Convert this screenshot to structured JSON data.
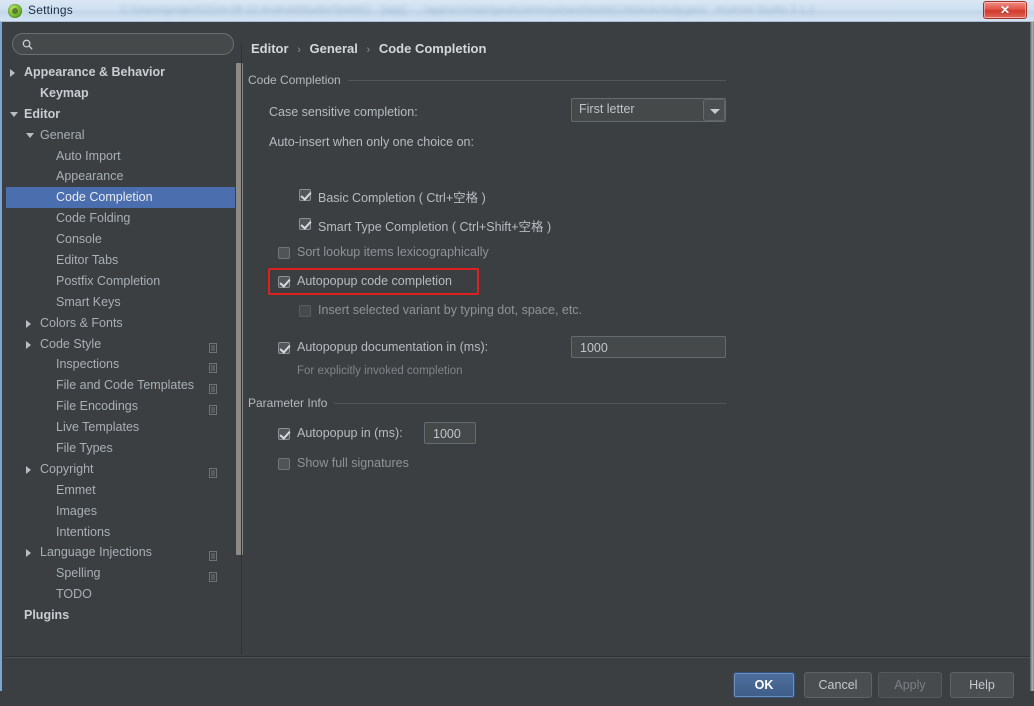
{
  "window": {
    "title": "Settings",
    "icon": "android-studio-icon",
    "background_text": "C:\\Users\\project\\2019-08-10 AndroidStudio\\Test001  - [app] - ...\\app\\src\\main\\java\\com\\myshare\\test001\\MainActivity.java - Android Studio 3.1.2",
    "close_label": "✕"
  },
  "search": {
    "value": "",
    "placeholder": "",
    "icon": "search-icon"
  },
  "breadcrumb": {
    "items": [
      "Editor",
      "General",
      "Code Completion"
    ],
    "separator": "›"
  },
  "sidebar": {
    "items": [
      {
        "label": "Appearance & Behavior",
        "indent": 0,
        "arrow": "right",
        "bold": true,
        "selected": false,
        "icon": false
      },
      {
        "label": "Keymap",
        "indent": 1,
        "arrow": "none",
        "bold": true,
        "selected": false,
        "icon": false
      },
      {
        "label": "Editor",
        "indent": 0,
        "arrow": "down",
        "bold": true,
        "selected": false,
        "icon": false
      },
      {
        "label": "General",
        "indent": 1,
        "arrow": "down",
        "bold": false,
        "selected": false,
        "icon": false
      },
      {
        "label": "Auto Import",
        "indent": 3,
        "arrow": "none",
        "bold": false,
        "selected": false,
        "icon": false
      },
      {
        "label": "Appearance",
        "indent": 3,
        "arrow": "none",
        "bold": false,
        "selected": false,
        "icon": false
      },
      {
        "label": "Code Completion",
        "indent": 3,
        "arrow": "none",
        "bold": false,
        "selected": true,
        "icon": false
      },
      {
        "label": "Code Folding",
        "indent": 3,
        "arrow": "none",
        "bold": false,
        "selected": false,
        "icon": false
      },
      {
        "label": "Console",
        "indent": 3,
        "arrow": "none",
        "bold": false,
        "selected": false,
        "icon": false
      },
      {
        "label": "Editor Tabs",
        "indent": 3,
        "arrow": "none",
        "bold": false,
        "selected": false,
        "icon": false
      },
      {
        "label": "Postfix Completion",
        "indent": 3,
        "arrow": "none",
        "bold": false,
        "selected": false,
        "icon": false
      },
      {
        "label": "Smart Keys",
        "indent": 3,
        "arrow": "none",
        "bold": false,
        "selected": false,
        "icon": false
      },
      {
        "label": "Colors & Fonts",
        "indent": 1,
        "arrow": "right",
        "bold": false,
        "selected": false,
        "icon": false
      },
      {
        "label": "Code Style",
        "indent": 1,
        "arrow": "right",
        "bold": false,
        "selected": false,
        "icon": true
      },
      {
        "label": "Inspections",
        "indent": 2,
        "arrow": "none",
        "bold": false,
        "selected": false,
        "icon": true
      },
      {
        "label": "File and Code Templates",
        "indent": 2,
        "arrow": "none",
        "bold": false,
        "selected": false,
        "icon": true
      },
      {
        "label": "File Encodings",
        "indent": 2,
        "arrow": "none",
        "bold": false,
        "selected": false,
        "icon": true
      },
      {
        "label": "Live Templates",
        "indent": 2,
        "arrow": "none",
        "bold": false,
        "selected": false,
        "icon": false
      },
      {
        "label": "File Types",
        "indent": 2,
        "arrow": "none",
        "bold": false,
        "selected": false,
        "icon": false
      },
      {
        "label": "Copyright",
        "indent": 1,
        "arrow": "right",
        "bold": false,
        "selected": false,
        "icon": true
      },
      {
        "label": "Emmet",
        "indent": 2,
        "arrow": "none",
        "bold": false,
        "selected": false,
        "icon": false
      },
      {
        "label": "Images",
        "indent": 2,
        "arrow": "none",
        "bold": false,
        "selected": false,
        "icon": false
      },
      {
        "label": "Intentions",
        "indent": 2,
        "arrow": "none",
        "bold": false,
        "selected": false,
        "icon": false
      },
      {
        "label": "Language Injections",
        "indent": 1,
        "arrow": "right",
        "bold": false,
        "selected": false,
        "icon": true
      },
      {
        "label": "Spelling",
        "indent": 2,
        "arrow": "none",
        "bold": false,
        "selected": false,
        "icon": true
      },
      {
        "label": "TODO",
        "indent": 2,
        "arrow": "none",
        "bold": false,
        "selected": false,
        "icon": false
      },
      {
        "label": "Plugins",
        "indent": 0,
        "arrow": "none",
        "bold": true,
        "selected": false,
        "icon": false
      }
    ]
  },
  "code_completion": {
    "section_title": "Code Completion",
    "case_sensitive_label": "Case sensitive completion:",
    "case_sensitive_value": "First letter",
    "auto_insert_label": "Auto-insert when only one choice on:",
    "basic_completion": {
      "label": "Basic Completion ( Ctrl+空格 )",
      "checked": true
    },
    "smart_type_completion": {
      "label": "Smart Type Completion ( Ctrl+Shift+空格 )",
      "checked": true
    },
    "sort_lookup": {
      "label": "Sort lookup items lexicographically",
      "checked": false
    },
    "autopopup_code": {
      "label": "Autopopup code completion",
      "checked": true,
      "highlighted": true
    },
    "insert_selected_variant": {
      "label": "Insert selected variant by typing dot, space, etc.",
      "checked": false,
      "disabled": true
    },
    "autopopup_doc": {
      "label": "Autopopup documentation in (ms):",
      "checked": true,
      "value": "1000"
    },
    "autopopup_doc_hint": "For explicitly invoked completion"
  },
  "parameter_info": {
    "section_title": "Parameter Info",
    "autopopup_in": {
      "label": "Autopopup in (ms):",
      "checked": true,
      "value": "1000"
    },
    "show_full_signatures": {
      "label": "Show full signatures",
      "checked": false
    }
  },
  "buttons": {
    "ok": "OK",
    "cancel": "Cancel",
    "apply": "Apply",
    "help": "Help"
  },
  "colors": {
    "background": "#3c3f41",
    "selection": "#4b6eaf",
    "highlight_box": "#e02020",
    "text": "#b6bcc0",
    "title_bar": "#cfe0f0"
  }
}
